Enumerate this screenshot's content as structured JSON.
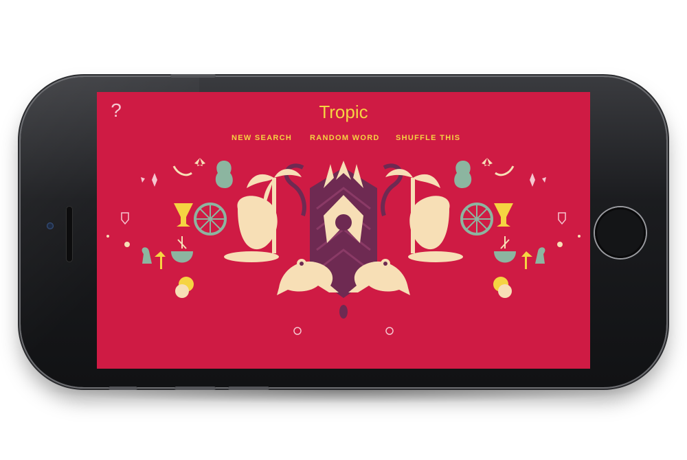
{
  "app": {
    "title": "Tropic",
    "help_icon_label": "?"
  },
  "nav": {
    "items": [
      {
        "label": "NEW SEARCH"
      },
      {
        "label": "RANDOM WORD"
      },
      {
        "label": "SHUFFLE THIS"
      }
    ]
  },
  "colors": {
    "background": "#cf1b44",
    "title": "#f5d442",
    "cream": "#f7dfb6",
    "mint": "#8cb5a0",
    "plum": "#6e2a52",
    "yellow": "#f5d442"
  },
  "illustration": {
    "icons": [
      "palm-tree-icon",
      "pineapple-icon",
      "frog-icon",
      "cocktail-icon",
      "citrus-wheel-icon",
      "pear-icon",
      "banana-icon",
      "bird-icon",
      "coconut-icon",
      "flamingo-icon",
      "feather-icon",
      "shield-icon",
      "fruit-bowl-icon"
    ]
  }
}
